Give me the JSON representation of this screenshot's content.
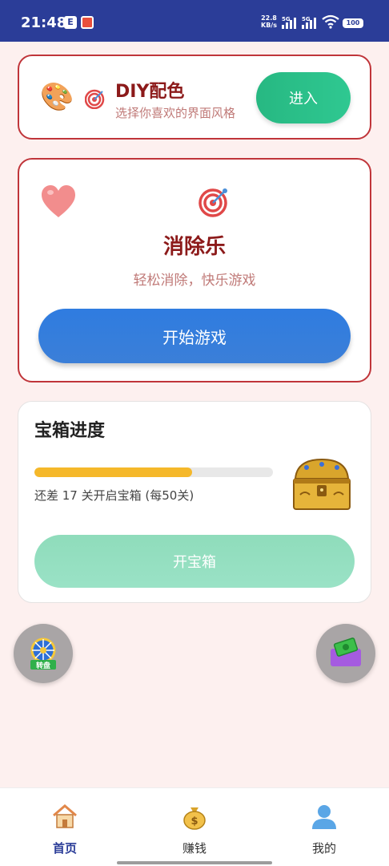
{
  "status_bar": {
    "time": "21:48",
    "net_speed_value": "22.8",
    "net_speed_unit": "KB/s",
    "sim1_label": "5G",
    "sim2_label": "5G",
    "battery": "100"
  },
  "diy_card": {
    "title": "DIY配色",
    "subtitle": "选择你喜欢的界面风格",
    "enter_label": "进入"
  },
  "game_card": {
    "title": "消除乐",
    "subtitle": "轻松消除，快乐游戏",
    "start_label": "开始游戏"
  },
  "chest_card": {
    "title": "宝箱进度",
    "progress_fraction": 0.66,
    "progress_text": "还差 17 关开启宝箱 (每50关)",
    "open_label": "开宝箱"
  },
  "fab_left": {
    "icon": "lucky-wheel-icon",
    "label": "转盘"
  },
  "fab_right": {
    "icon": "money-icon"
  },
  "tabs": [
    {
      "label": "首页",
      "icon": "home-icon",
      "active": true
    },
    {
      "label": "赚钱",
      "icon": "money-bag-icon",
      "active": false
    },
    {
      "label": "我的",
      "icon": "user-icon",
      "active": false
    }
  ],
  "colors": {
    "status_bar": "#2b3d98",
    "card_border": "#c0353a",
    "title_red": "#8c1a1a",
    "enter_green": "#27b882",
    "start_blue": "#2f7ce0",
    "progress": "#f5b82a",
    "open_green": "#8fdcbb"
  }
}
